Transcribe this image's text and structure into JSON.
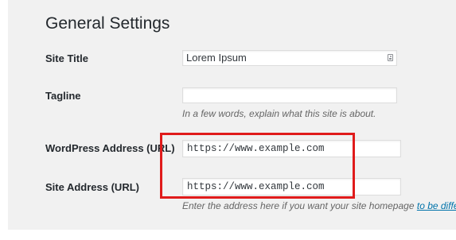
{
  "page": {
    "title": "General Settings"
  },
  "fields": {
    "site_title": {
      "label": "Site Title",
      "value": "Lorem Ipsum"
    },
    "tagline": {
      "label": "Tagline",
      "value": "",
      "description": "In a few words, explain what this site is about."
    },
    "wordpress_address": {
      "label": "WordPress Address (URL)",
      "value": "https://www.example.com"
    },
    "site_address": {
      "label": "Site Address (URL)",
      "value": "https://www.example.com",
      "description": "Enter the address here if you want your site homepage",
      "description_link": "to be differen"
    }
  },
  "annotation": {
    "highlight_color": "#e01b1b"
  },
  "icons": {
    "site_title_field_icon": "contact-card-icon"
  }
}
